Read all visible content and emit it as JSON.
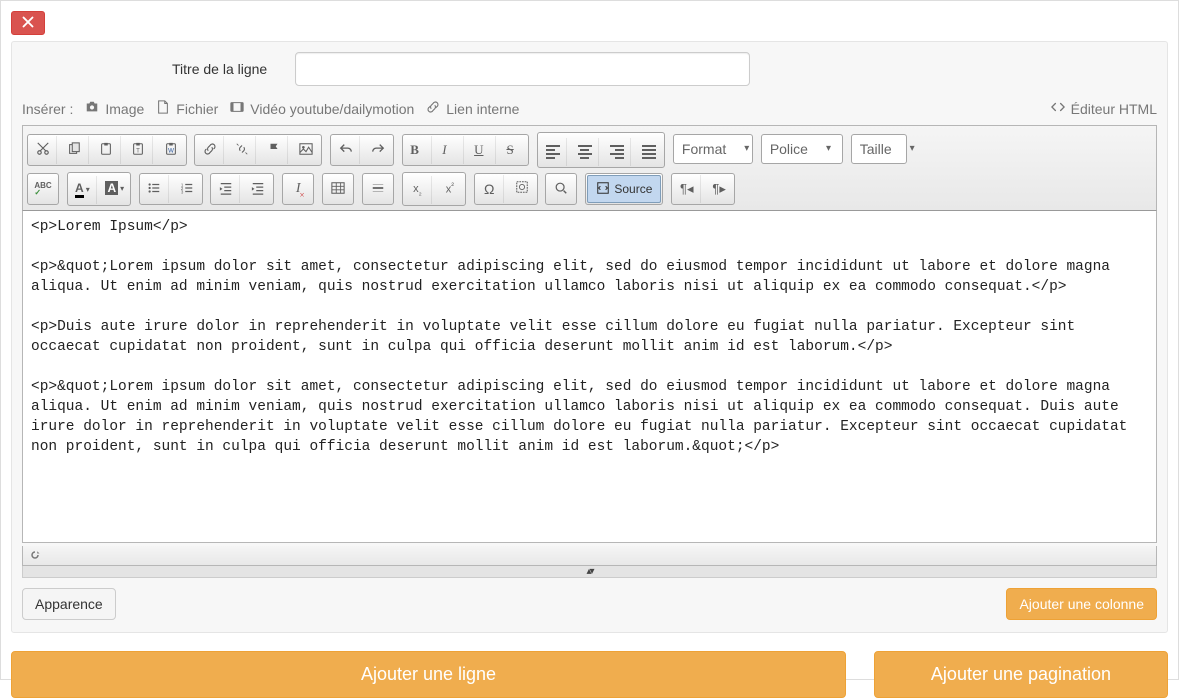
{
  "title_row": {
    "label": "Titre de la ligne",
    "value": ""
  },
  "insert_bar": {
    "label": "Insérer :",
    "image": "Image",
    "file": "Fichier",
    "video": "Vidéo youtube/dailymotion",
    "internal_link": "Lien interne",
    "html_editor": "Éditeur HTML"
  },
  "toolbar": {
    "format": "Format",
    "font": "Police",
    "size": "Taille",
    "source": "Source"
  },
  "source_text": "<p>Lorem Ipsum</p>\n\n<p>&quot;Lorem ipsum dolor sit amet, consectetur adipiscing elit, sed do eiusmod tempor incididunt ut labore et dolore magna aliqua. Ut enim ad minim veniam, quis nostrud exercitation ullamco laboris nisi ut aliquip ex ea commodo consequat.</p>\n\n<p>Duis aute irure dolor in reprehenderit in voluptate velit esse cillum dolore eu fugiat nulla pariatur. Excepteur sint occaecat cupidatat non proident, sunt in culpa qui officia deserunt mollit anim id est laborum.</p>\n\n<p>&quot;Lorem ipsum dolor sit amet, consectetur adipiscing elit, sed do eiusmod tempor incididunt ut labore et dolore magna aliqua. Ut enim ad minim veniam, quis nostrud exercitation ullamco laboris nisi ut aliquip ex ea commodo consequat. Duis aute irure dolor in reprehenderit in voluptate velit esse cillum dolore eu fugiat nulla pariatur. Excepteur sint occaecat cupidatat non proident, sunt in culpa qui officia deserunt mollit anim id est laborum.&quot;</p>",
  "buttons": {
    "appearance": "Apparence",
    "add_column": "Ajouter une colonne",
    "add_line": "Ajouter une ligne",
    "add_pagination": "Ajouter une pagination"
  }
}
